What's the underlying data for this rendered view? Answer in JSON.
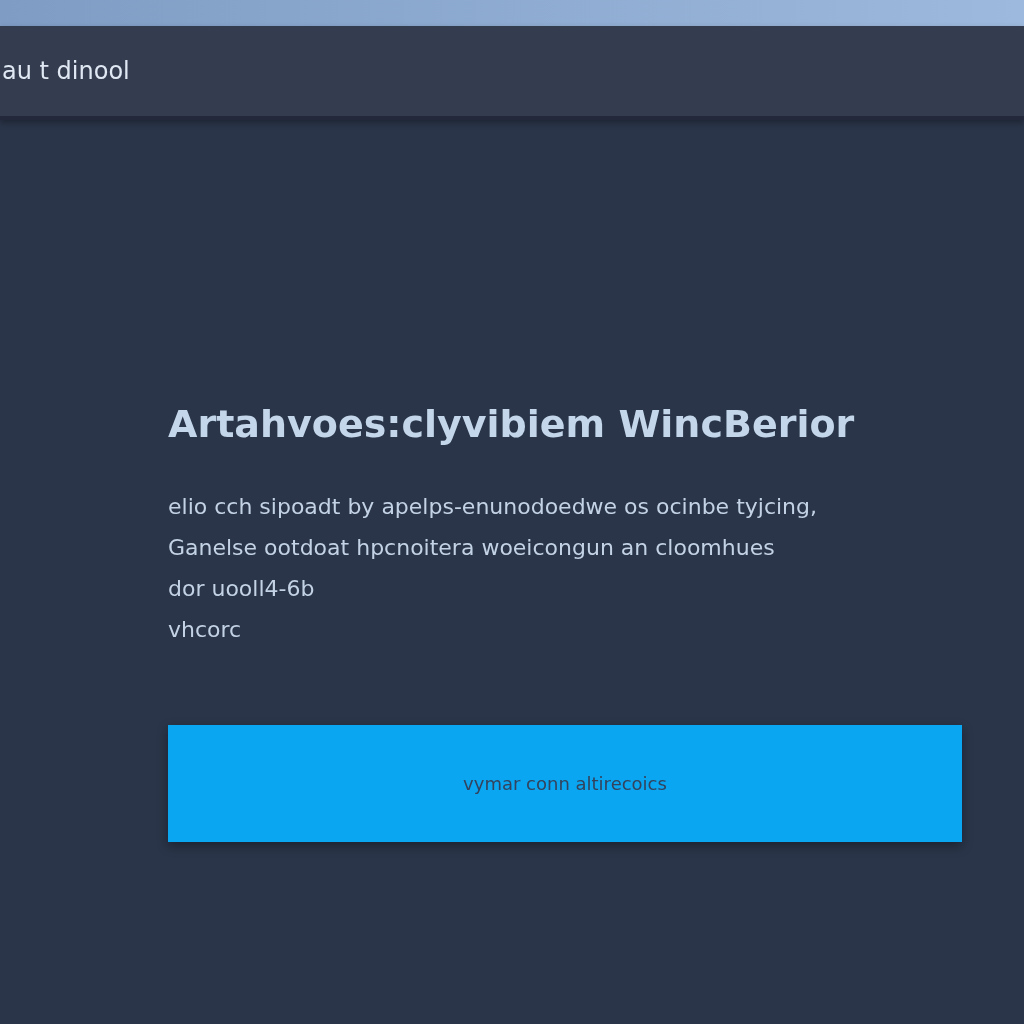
{
  "header": {
    "title": "au t dinool"
  },
  "heading": "Artahvoes:clyvibiem WincBerior",
  "paragraph_lines": [
    "elio cch sipoadt by apelps-enunodoedwe os ocinbe tyjcing,",
    "Ganelse ootdoat hpcnoitera woeicongun an cloomhues",
    "dor uooll4-6b",
    "vhcorc"
  ],
  "button": {
    "label": "vymar conn altirecoics"
  }
}
